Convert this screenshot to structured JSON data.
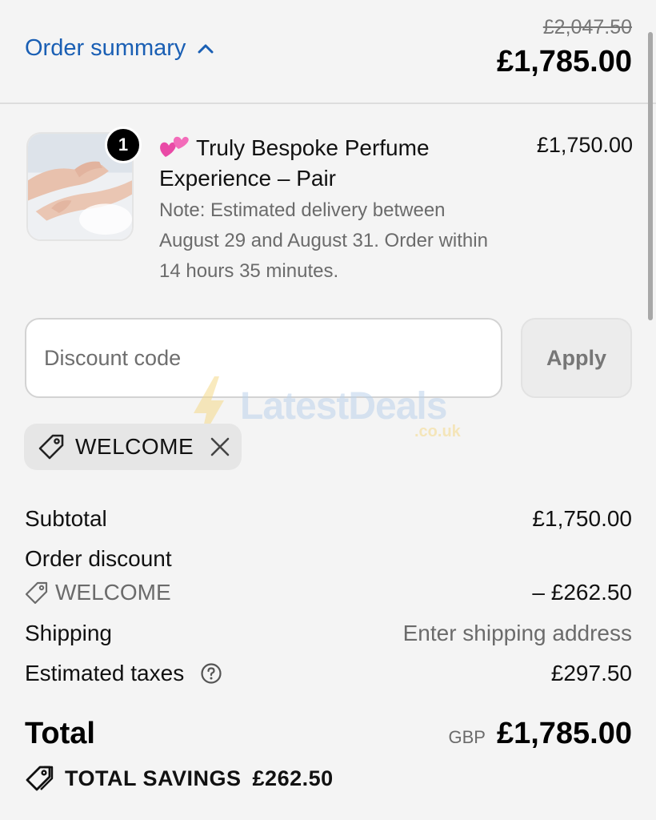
{
  "header": {
    "toggle_label": "Order summary",
    "original_price": "£2,047.50",
    "total": "£1,785.00"
  },
  "product": {
    "quantity": "1",
    "emoji": "💕",
    "name": "Truly Bespoke Perfume Experience – Pair",
    "note": "Note: Estimated delivery between August 29 and August 31. Order within 14 hours 35 minutes.",
    "price": "£1,750.00"
  },
  "discount": {
    "placeholder": "Discount code",
    "apply_label": "Apply",
    "applied_code": "WELCOME"
  },
  "watermark": {
    "brand": "LatestDeals",
    "sub": ".co.uk"
  },
  "summary": {
    "subtotal_label": "Subtotal",
    "subtotal_value": "£1,750.00",
    "order_discount_label": "Order discount",
    "order_discount_code": "WELCOME",
    "order_discount_value": "– £262.50",
    "shipping_label": "Shipping",
    "shipping_value": "Enter shipping address",
    "taxes_label": "Estimated taxes",
    "taxes_value": "£297.50",
    "total_label": "Total",
    "currency": "GBP",
    "total_value": "£1,785.00",
    "savings_label": "TOTAL SAVINGS",
    "savings_value": "£262.50"
  },
  "colors": {
    "link": "#1a5fb4",
    "background": "#f4f4f4",
    "muted_text": "#6b6b6b"
  },
  "icons": [
    "chevron-up-icon",
    "heart-icon",
    "tag-icon",
    "close-icon",
    "help-icon",
    "savings-tag-icon"
  ]
}
